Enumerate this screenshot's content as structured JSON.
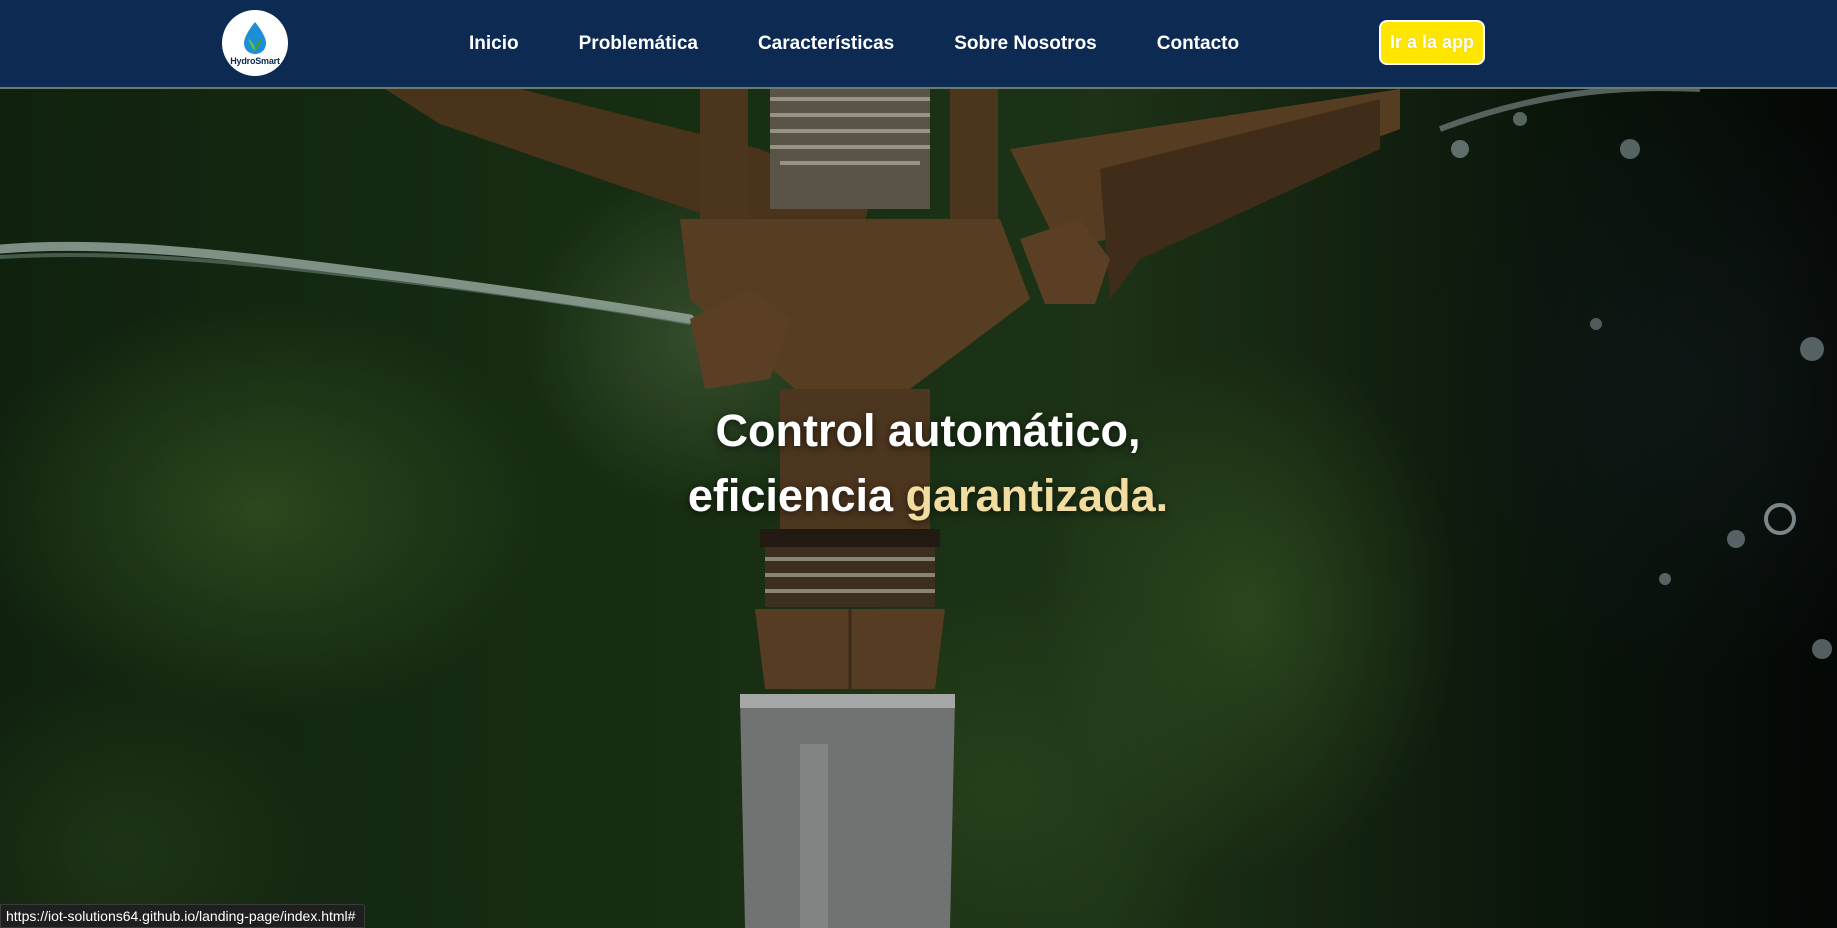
{
  "brand": {
    "logo_text": "HydroSmart"
  },
  "nav": {
    "items": [
      {
        "label": "Inicio"
      },
      {
        "label": "Problemática"
      },
      {
        "label": "Características"
      },
      {
        "label": "Sobre Nosotros"
      },
      {
        "label": "Contacto"
      }
    ],
    "cta_label": "Ir a la app"
  },
  "hero": {
    "line1": "Control automático,",
    "line2_plain": "eficiencia",
    "line2_accent": "garantizada."
  },
  "status_url": "https://iot-solutions64.github.io/landing-page/index.html#",
  "colors": {
    "navbar": "#0c2a52",
    "cta": "#ffe600",
    "accent_text": "#f2dca0"
  },
  "icons": {
    "logo": "water-drop-leaf-icon"
  }
}
